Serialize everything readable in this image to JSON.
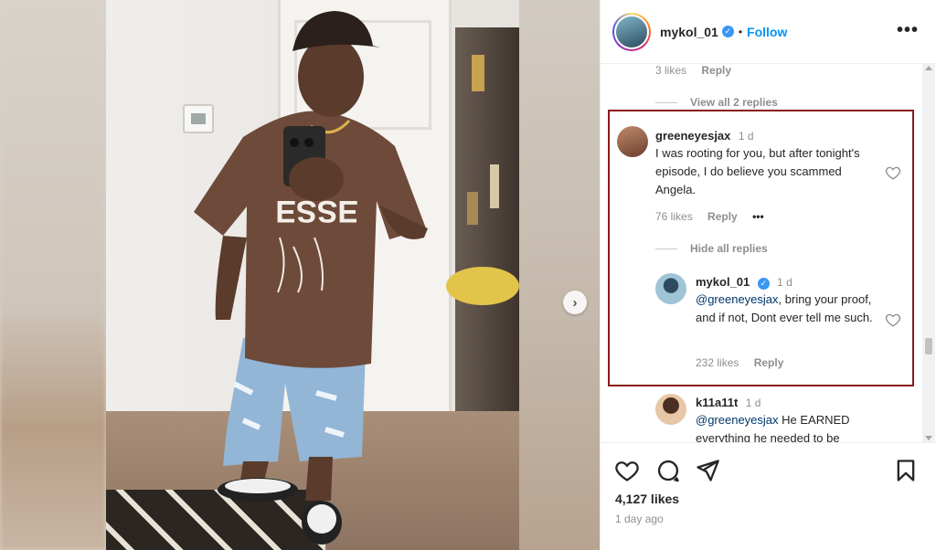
{
  "post": {
    "username": "mykol_01",
    "separator": "•",
    "follow_label": "Follow",
    "more_label": "•••",
    "next_arrow": "›"
  },
  "comments": {
    "prev_likes": "3 likes",
    "prev_reply": "Reply",
    "view_replies": "View all 2 replies",
    "main": {
      "username": "greeneyesjax",
      "time": "1 d",
      "text": "I was rooting for you, but after tonight's episode, I do believe you scammed Angela.",
      "likes": "76 likes",
      "reply": "Reply",
      "more": "•••",
      "hide_replies": "Hide all replies"
    },
    "reply1": {
      "username": "mykol_01",
      "time": "1 d",
      "mention": "@greeneyesjax",
      "text": ", bring your proof, and if not, Dont ever tell me such.",
      "likes": "232 likes",
      "reply": "Reply"
    },
    "reply2": {
      "username": "k11a11t",
      "time": "1 d",
      "mention": "@greeneyesjax",
      "text": " He EARNED everything he needed to be"
    }
  },
  "footer": {
    "likes": "4,127 likes",
    "time_ago": "1 day ago"
  },
  "colors": {
    "follow": "#0095f6",
    "verified": "#3897f0",
    "highlight_border": "#8b1a1a",
    "mention": "#00376b"
  },
  "icons": [
    "heart-icon",
    "comment-icon",
    "share-icon",
    "bookmark-icon",
    "verified-icon",
    "more-icon",
    "chevron-right-icon"
  ]
}
